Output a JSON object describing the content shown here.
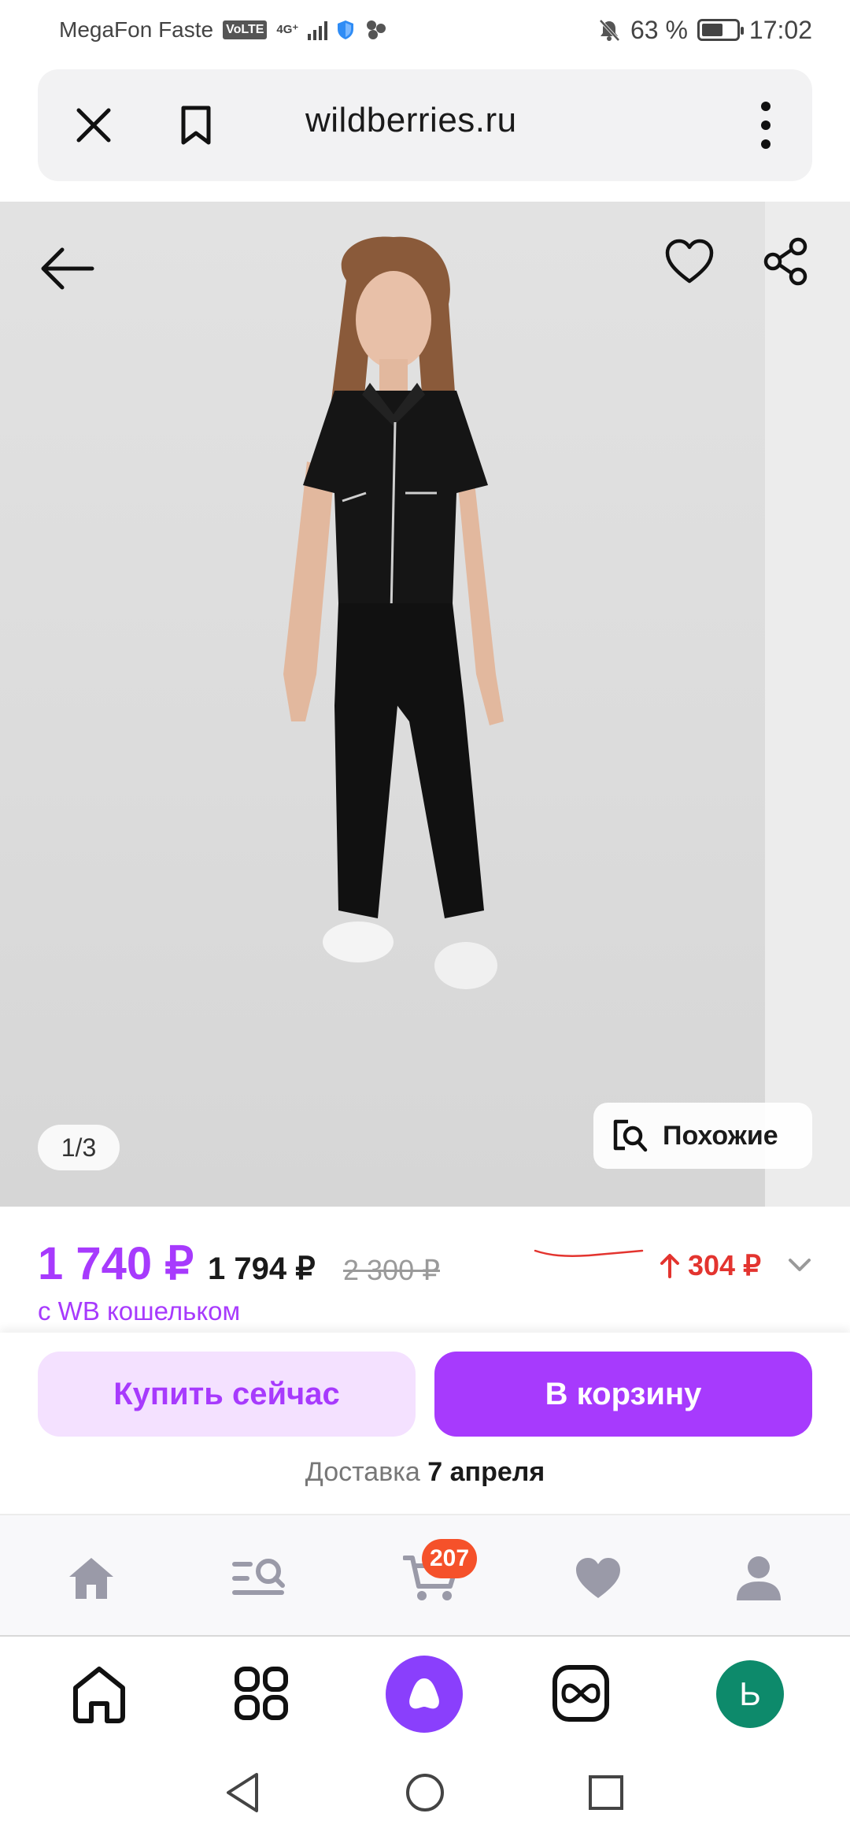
{
  "status_bar": {
    "carrier": "MegaFon Faste",
    "volte": "VoLTE",
    "network": "4G⁺",
    "battery_percent": "63 %",
    "battery_level": 0.63,
    "time": "17:02"
  },
  "browser": {
    "url": "wildberries.ru"
  },
  "product": {
    "image_counter": "1/3",
    "similar_label": "Похожие",
    "price": "1 740 ₽",
    "price_secondary": "1 794 ₽",
    "price_old": "2 300 ₽",
    "wallet_note": "с WB кошельком",
    "price_diff": "304 ₽",
    "price_color": "#a73afd",
    "diff_color": "#e3342f"
  },
  "actions": {
    "buy_now": "Купить сейчас",
    "add_to_cart": "В корзину",
    "delivery_label": "Доставка",
    "delivery_date": "7 апреля"
  },
  "site_nav": {
    "items": [
      {
        "icon": "home-icon"
      },
      {
        "icon": "catalog-search-icon"
      },
      {
        "icon": "cart-icon"
      },
      {
        "icon": "heart-icon"
      },
      {
        "icon": "profile-icon"
      }
    ],
    "cart_badge": "207"
  },
  "browser_toolbar": {
    "avatar_letter": "Ь",
    "accent": "#8a3ffc"
  }
}
